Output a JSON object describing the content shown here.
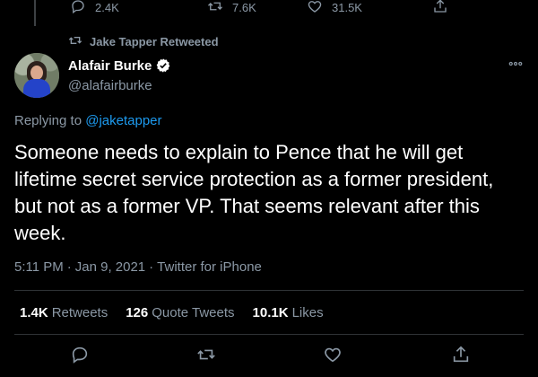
{
  "previous_tweet": {
    "reply_count": "2.4K",
    "retweet_count": "7.6K",
    "like_count": "31.5K"
  },
  "retweet_banner": "Jake Tapper Retweeted",
  "author": {
    "name": "Alafair Burke",
    "handle": "@alafairburke",
    "verified": true
  },
  "replying": {
    "prefix": "Replying to",
    "mention": "@jaketapper"
  },
  "tweet_text": "Someone needs to explain to Pence that he will get lifetime secret service protection as a former president, but not as a former VP. That seems relevant after this week.",
  "meta": {
    "time": "5:11 PM",
    "separator": "·",
    "date": "Jan 9, 2021",
    "source": "Twitter for iPhone"
  },
  "stats": {
    "retweets_value": "1.4K",
    "retweets_label": "Retweets",
    "quotes_value": "126",
    "quotes_label": "Quote Tweets",
    "likes_value": "10.1K",
    "likes_label": "Likes"
  },
  "icons": {
    "reply": "reply-icon",
    "retweet": "retweet-icon",
    "like": "heart-icon",
    "share": "share-icon",
    "more": "more-icon",
    "verified": "verified-badge-icon"
  },
  "colors": {
    "background": "#000000",
    "text": "#ffffff",
    "muted": "#8b98a5",
    "link": "#1d9bf0",
    "divider": "#2f3336"
  }
}
